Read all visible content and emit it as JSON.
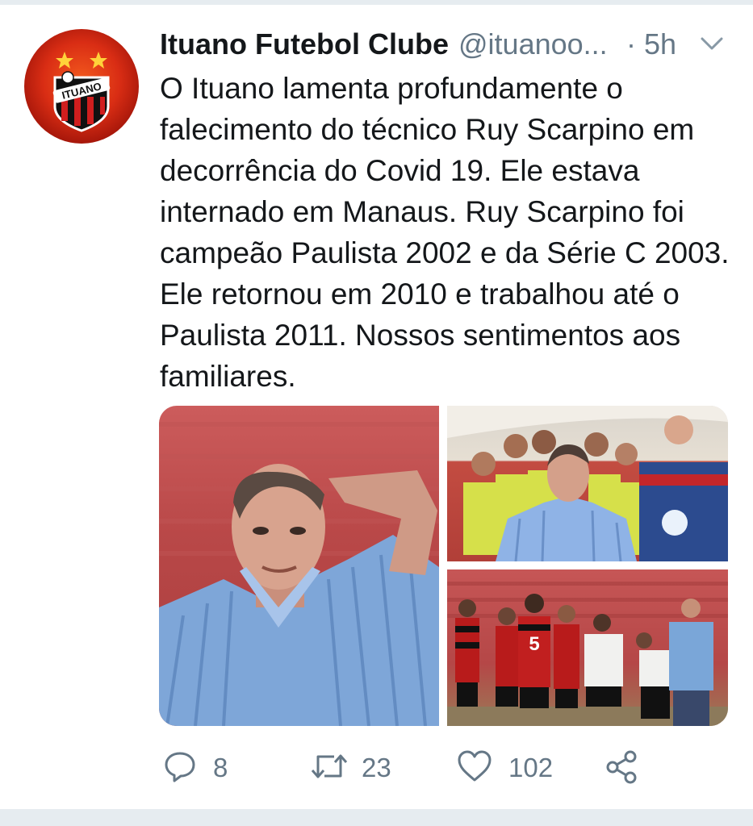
{
  "tweet": {
    "author_name": "Ituano Futebol Clube",
    "handle": "@ituanoo...",
    "time": "· 5h",
    "text": "O Ituano lamenta profundamente o falecimento do técnico Ruy Scarpino em decorrência do Covid 19. Ele estava internado em Manaus. Ruy Scarpino foi campeão Paulista 2002 e da Série C 2003. Ele retornou em 2010 e trabalhou até o Paulista 2011. Nossos sentimentos aos familiares.",
    "avatar_logo_text": "ITUANO"
  },
  "media": {
    "photo_count": 3,
    "jersey_number": "5"
  },
  "actions": {
    "replies": "8",
    "retweets": "23",
    "likes": "102"
  },
  "icons": {
    "reply": "reply-icon",
    "retweet": "retweet-icon",
    "like": "heart-icon",
    "share": "share-icon",
    "menu": "chevron-down-icon"
  },
  "colors": {
    "text": "#14171a",
    "secondary": "#657786",
    "separator": "#e6ecf0",
    "brand_red": "#d92d14"
  }
}
